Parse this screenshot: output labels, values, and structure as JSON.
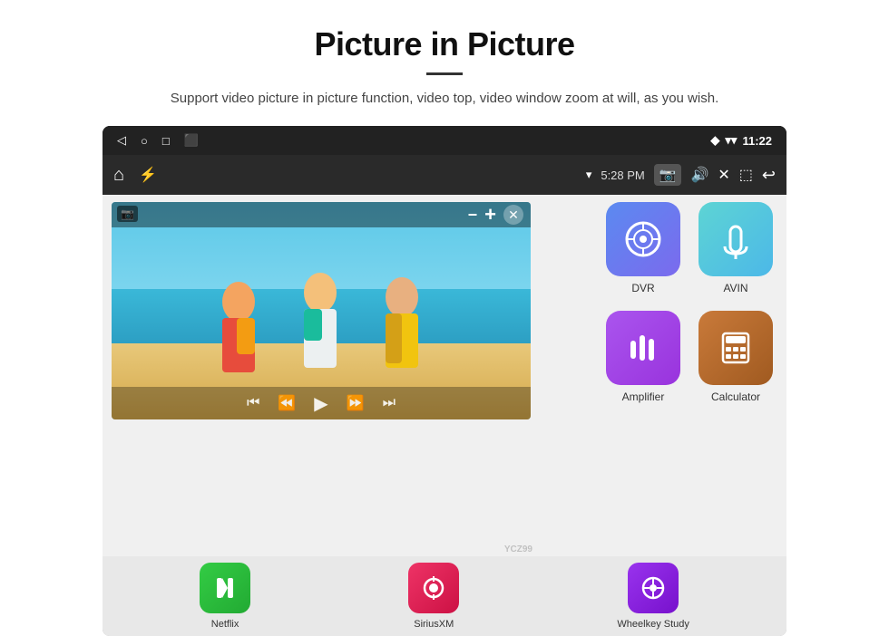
{
  "header": {
    "title": "Picture in Picture",
    "description": "Support video picture in picture function, video top, video window zoom at will, as you wish."
  },
  "status_bar": {
    "time": "11:22",
    "icons_left": [
      "back",
      "home",
      "square",
      "cast"
    ],
    "icons_right": [
      "location",
      "wifi",
      "time"
    ]
  },
  "toolbar": {
    "time": "5:28 PM",
    "icons": [
      "home",
      "usb",
      "wifi",
      "camera",
      "volume",
      "close",
      "pip",
      "back"
    ]
  },
  "pip": {
    "controls": [
      "minimize",
      "expand",
      "close"
    ]
  },
  "apps": [
    {
      "name": "DVR",
      "color_class": "dvr-bg",
      "icon": "📡"
    },
    {
      "name": "AVIN",
      "color_class": "avin-bg",
      "icon": "🎛"
    },
    {
      "name": "Amplifier",
      "color_class": "amp-bg",
      "icon": "🎚"
    },
    {
      "name": "Calculator",
      "color_class": "calc-bg",
      "icon": "🧮"
    }
  ],
  "bottom_apps": [
    {
      "name": "Netflix",
      "color_class": "netflix-bg",
      "icon": "▶"
    },
    {
      "name": "SiriusXM",
      "color_class": "sirius-bg",
      "icon": "📻"
    },
    {
      "name": "Wheelkey Study",
      "color_class": "wheelkey-bg",
      "icon": "🎓"
    }
  ]
}
